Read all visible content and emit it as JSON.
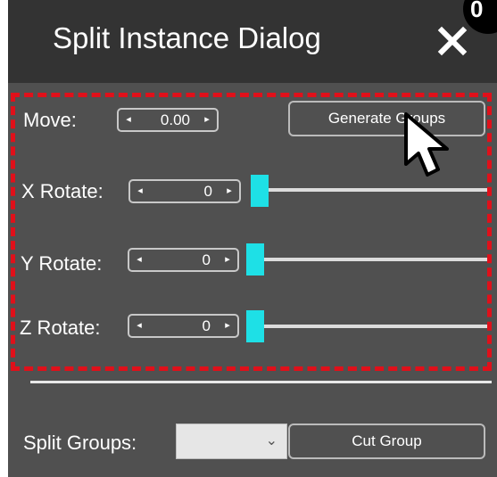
{
  "dialog": {
    "title": "Split Instance Dialog",
    "close_label": "✕",
    "step_badge": "0"
  },
  "move": {
    "label": "Move:",
    "value": "0.00",
    "left_arrow": "◂",
    "right_arrow": "▸"
  },
  "generate_button": "Generate Groups",
  "x_rotate": {
    "label": "X Rotate:",
    "value": "0",
    "slider_level": 0
  },
  "y_rotate": {
    "label": "Y Rotate:",
    "value": "0",
    "slider_level": 0
  },
  "z_rotate": {
    "label": "Z Rotate:",
    "value": "0",
    "slider_level": 0
  },
  "split_groups": {
    "label": "Split Groups:",
    "selected": "",
    "chevron": "⌄"
  },
  "cut_button": "Cut Group",
  "colors": {
    "background": "#505050",
    "titlebar": "#333333",
    "highlight": "#e0101a",
    "slider_handle": "#1ee0e6"
  },
  "icons": {
    "close": "close-icon",
    "cursor": "mouse-pointer-icon"
  }
}
